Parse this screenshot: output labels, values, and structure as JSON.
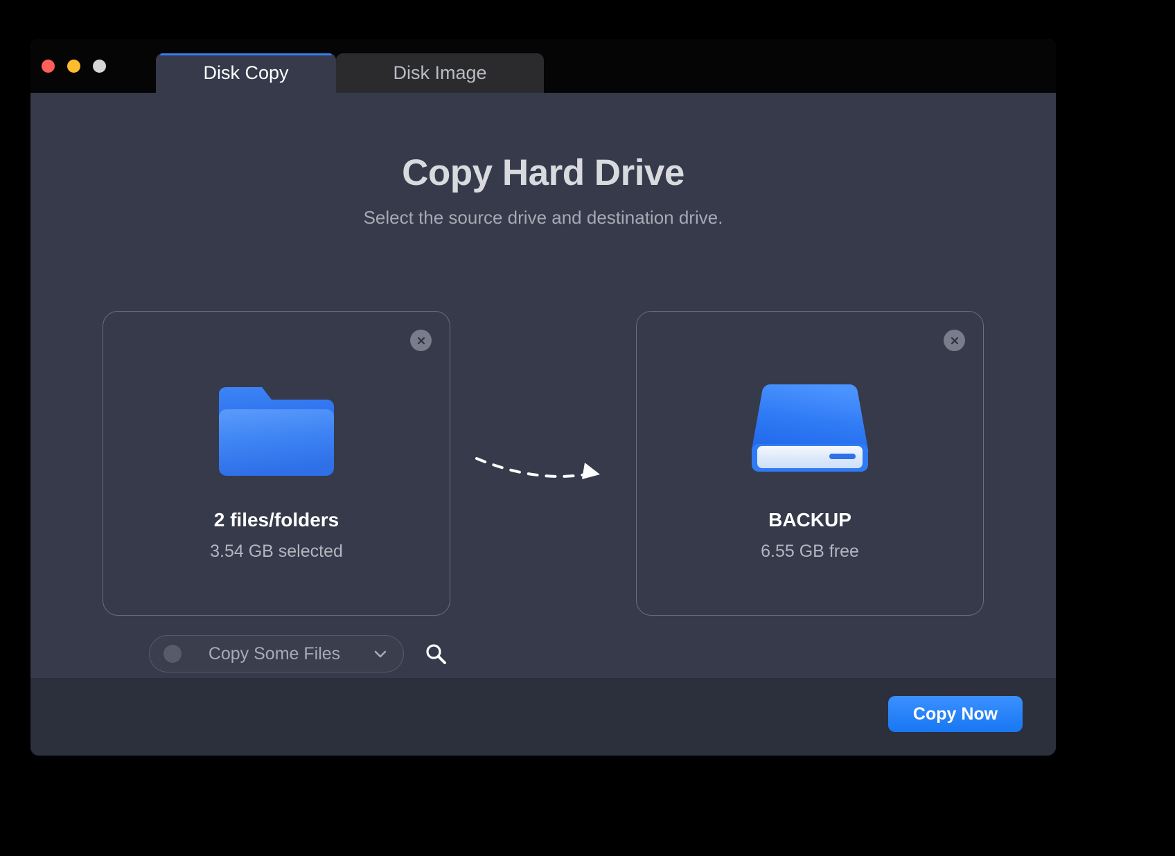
{
  "window": {
    "traffic_lights": [
      {
        "name": "close",
        "color": "#ff5f57"
      },
      {
        "name": "minimize",
        "color": "#febc2e"
      },
      {
        "name": "zoom",
        "color": "#d6d6d6"
      }
    ]
  },
  "tabs": [
    {
      "label": "Disk Copy",
      "active": true
    },
    {
      "label": "Disk Image",
      "active": false
    }
  ],
  "header": {
    "title": "Copy Hard Drive",
    "subtitle": "Select the source drive and destination drive."
  },
  "source_card": {
    "icon": "folder-icon",
    "label": "2 files/folders",
    "sublabel": "3.54 GB selected",
    "close_icon": "close-icon"
  },
  "destination_card": {
    "icon": "hard-drive-icon",
    "label": "BACKUP",
    "sublabel": "6.55 GB free",
    "close_icon": "close-icon"
  },
  "arrow": {
    "icon": "dashed-arrow-icon"
  },
  "copy_mode": {
    "selected": "Copy Some Files",
    "chevron_icon": "chevron-down-icon",
    "search_icon": "search-icon"
  },
  "footer": {
    "primary_button": "Copy Now"
  },
  "colors": {
    "accent": "#1877f2",
    "window_bg": "#363a4a",
    "titlebar_bg": "#050506",
    "footer_bg": "#2c2f3c",
    "card_border": "#6b7080",
    "text_primary": "#ffffff",
    "text_secondary": "#b2b6c0"
  }
}
